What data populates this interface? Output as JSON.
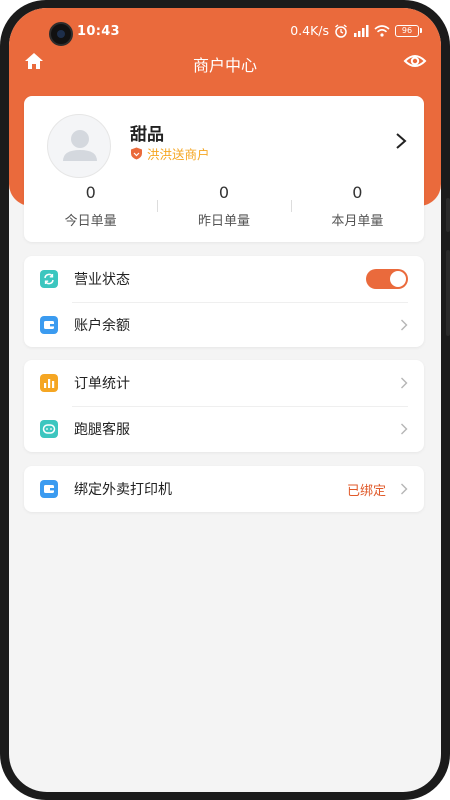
{
  "colors": {
    "accent": "#ea6a3c",
    "tag": "#f5a623",
    "teal_icon": "#3cc6bf",
    "blue_icon": "#3b9bf0",
    "orange_icon": "#f5a623",
    "status_text": "#e05a2a"
  },
  "status_bar": {
    "time": "10:43",
    "net_speed": "0.4K/s",
    "battery": "96",
    "icons": [
      "camera-icon",
      "alarm-icon",
      "signal-icon",
      "wifi-icon",
      "battery-icon"
    ]
  },
  "nav": {
    "title": "商户中心",
    "left_icon": "home-icon",
    "right_icon": "eye-icon"
  },
  "profile": {
    "name": "甜品",
    "tag": "洪洪送商户",
    "tag_icon": "shield-icon",
    "avatar_icon": "avatar-placeholder-icon"
  },
  "stats": [
    {
      "value": "0",
      "label": "今日单量"
    },
    {
      "value": "0",
      "label": "昨日单量"
    },
    {
      "value": "0",
      "label": "本月单量"
    }
  ],
  "menu": {
    "business_status": {
      "label": "营业状态",
      "icon": "refresh-icon",
      "enabled": true
    },
    "account_balance": {
      "label": "账户余额",
      "icon": "wallet-icon"
    },
    "order_stats": {
      "label": "订单统计",
      "icon": "bar-chart-icon"
    },
    "errand_service": {
      "label": "跑腿客服",
      "icon": "chat-icon"
    },
    "bind_printer": {
      "label": "绑定外卖打印机",
      "icon": "printer-icon",
      "status": "已绑定"
    }
  }
}
